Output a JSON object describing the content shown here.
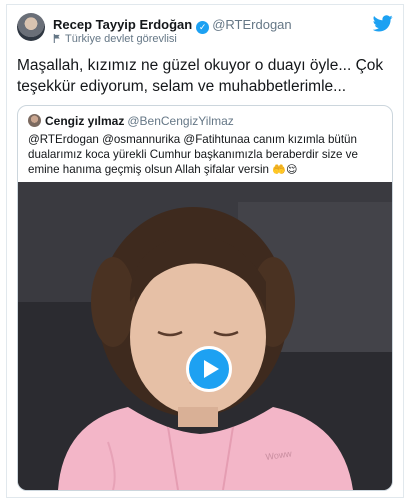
{
  "author": {
    "display_name": "Recep Tayyip Erdoğan",
    "verified_badge": "✓",
    "handle": "@RTErdogan",
    "label": "Türkiye devlet görevlisi"
  },
  "tweet": {
    "text": "Maşallah, kızımız ne güzel okuyor o duayı öyle... Çok teşekkür ediyorum, selam ve muhabbetlerimle..."
  },
  "quoted": {
    "display_name": "Cengiz yılmaz",
    "handle": "@BenCengizYilmaz",
    "text": "@RTErdogan @osmannurika @Fatihtunaa canım kızımla bütün dualarımız koca yürekli Cumhur başkanımızla beraberdir size ve emine hanıma geçmiş olsun Allah şifalar versin",
    "emojis": "🤲😌"
  },
  "video": {
    "sweater_print": "Woww"
  },
  "colors": {
    "accent": "#1da1f2",
    "text": "#14171a",
    "secondary": "#657786",
    "border": "#e1e8ed"
  },
  "icons": {
    "brand": "twitter-bird-icon",
    "verified": "verified-badge-icon",
    "label": "flag-icon",
    "play": "play-icon"
  }
}
